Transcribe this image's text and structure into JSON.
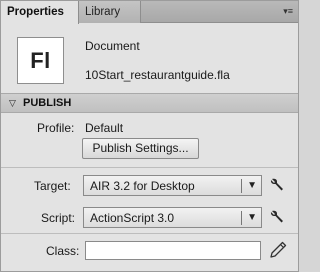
{
  "tabs": {
    "properties": "Properties",
    "library": "Library",
    "menu_glyph": "▾≡"
  },
  "document": {
    "icon_text": "Fl",
    "type": "Document",
    "filename": "10Start_restaurantguide.fla"
  },
  "publish": {
    "section_arrow": "▽",
    "section_title": "PUBLISH",
    "profile_label": "Profile:",
    "profile_value": "Default",
    "settings_button": "Publish Settings...",
    "target_label": "Target:",
    "target_value": "AIR 3.2 for Desktop",
    "script_label": "Script:",
    "script_value": "ActionScript 3.0",
    "class_label": "Class:",
    "class_value": "",
    "dropdown_arrow": "▼"
  },
  "icons": {
    "wrench": "wrench-icon",
    "pencil": "pencil-icon",
    "panel_menu": "panel-menu-icon"
  }
}
